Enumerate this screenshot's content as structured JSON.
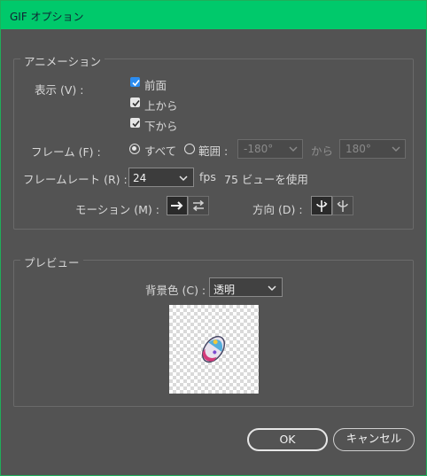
{
  "window": {
    "title": "GIF オプション"
  },
  "animation": {
    "group_title": "アニメーション",
    "display_label": "表示 (V) :",
    "options": [
      {
        "label": "前面",
        "checked": true,
        "accent": "#2b8cf0"
      },
      {
        "label": "上から",
        "checked": true
      },
      {
        "label": "下から",
        "checked": true
      }
    ],
    "frames_label": "フレーム (F) :",
    "frames_all": "すべて",
    "frames_range": "範囲 :",
    "range_from": "-180°",
    "range_to_label": "から",
    "range_to": "180°",
    "framerate_label": "フレームレート (R) :",
    "framerate_value": "24",
    "fps_label": "fps",
    "fps_note": "75 ビューを使用",
    "motion_label": "モーション (M) :",
    "motion_icons": [
      "arrow-right-icon",
      "swap-arrows-icon"
    ],
    "direction_label": "方向 (D) :",
    "direction_icons": [
      "rotate-clockwise-icon",
      "rotate-counterclockwise-icon"
    ]
  },
  "preview": {
    "group_title": "プレビュー",
    "bg_label": "背景色 (C) :",
    "bg_value": "透明"
  },
  "buttons": {
    "ok": "OK",
    "cancel": "キャンセル"
  },
  "colors": {
    "titlebar": "#00c96b",
    "panel": "#535353",
    "accent": "#2b8cf0"
  }
}
